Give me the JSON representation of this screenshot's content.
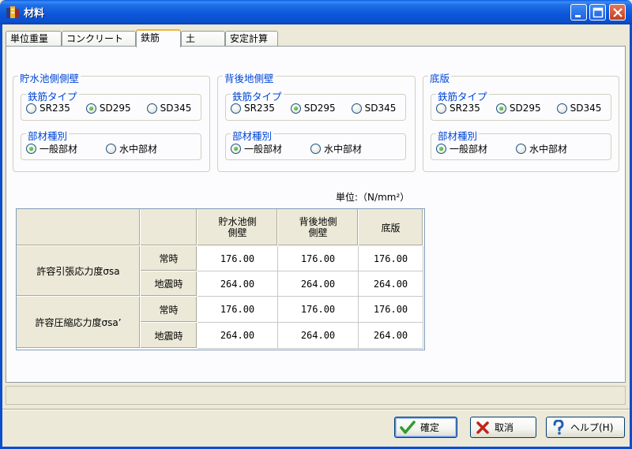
{
  "window": {
    "title": "材料",
    "icon": "building-icon"
  },
  "tabs": [
    {
      "label": "単位重量",
      "active": false
    },
    {
      "label": "コンクリート",
      "active": false
    },
    {
      "label": "鉄筋",
      "active": true
    },
    {
      "label": "土",
      "active": false
    },
    {
      "label": "安定計算",
      "active": false
    }
  ],
  "groups": [
    {
      "title": "貯水池側側壁",
      "rebar_type": {
        "title": "鉄筋タイプ",
        "options": [
          "SR235",
          "SD295",
          "SD345"
        ],
        "selected": "SD295"
      },
      "member_type": {
        "title": "部材種別",
        "options": [
          "一般部材",
          "水中部材"
        ],
        "selected": "一般部材"
      }
    },
    {
      "title": "背後地側壁",
      "rebar_type": {
        "title": "鉄筋タイプ",
        "options": [
          "SR235",
          "SD295",
          "SD345"
        ],
        "selected": "SD295"
      },
      "member_type": {
        "title": "部材種別",
        "options": [
          "一般部材",
          "水中部材"
        ],
        "selected": "一般部材"
      }
    },
    {
      "title": "底版",
      "rebar_type": {
        "title": "鉄筋タイプ",
        "options": [
          "SR235",
          "SD295",
          "SD345"
        ],
        "selected": "SD295"
      },
      "member_type": {
        "title": "部材種別",
        "options": [
          "一般部材",
          "水中部材"
        ],
        "selected": "一般部材"
      }
    }
  ],
  "unit": "単位:（N/mm²）",
  "table": {
    "columns": [
      "貯水池側\n側壁",
      "背後地側\n側壁",
      "底版"
    ],
    "rows": [
      {
        "group": "許容引張応力度σsa",
        "sub": "常時",
        "values": [
          "176.00",
          "176.00",
          "176.00"
        ]
      },
      {
        "group": "許容引張応力度σsa",
        "sub": "地震時",
        "values": [
          "264.00",
          "264.00",
          "264.00"
        ]
      },
      {
        "group": "許容圧縮応力度σsa’",
        "sub": "常時",
        "values": [
          "176.00",
          "176.00",
          "176.00"
        ]
      },
      {
        "group": "許容圧縮応力度σsa’",
        "sub": "地震時",
        "values": [
          "264.00",
          "264.00",
          "264.00"
        ]
      }
    ]
  },
  "buttons": {
    "ok": {
      "label": "確定",
      "icon": "checkmark-icon"
    },
    "cancel": {
      "label": "取消",
      "icon": "x-mark-icon"
    },
    "help": {
      "label": "ヘルプ(H)",
      "icon": "help-question-icon"
    }
  },
  "colors": {
    "titlebar": "#0a5de6",
    "group_title": "#0046d5",
    "tab_active_accent": "#f0b440"
  }
}
